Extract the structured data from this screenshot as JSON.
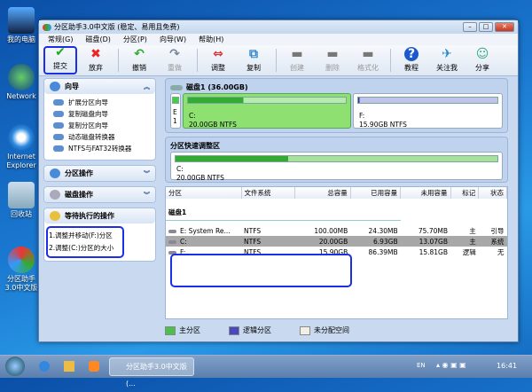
{
  "desktop": {
    "icons": [
      "我的电脑",
      "Network",
      "Internet Explorer",
      "回收站",
      "分区助手3.0中文版"
    ]
  },
  "window": {
    "title": "分区助手3.0中文版 (稳定、易用且免费)",
    "controls": [
      "minimize",
      "maximize",
      "close"
    ]
  },
  "menu": [
    "常规(G)",
    "磁盘(D)",
    "分区(P)",
    "向导(W)",
    "帮助(H)"
  ],
  "toolbar": [
    {
      "label": "提交",
      "icon": "check-icon",
      "enabled": true
    },
    {
      "label": "放弃",
      "icon": "x-icon",
      "enabled": true
    },
    {
      "label": "撤销",
      "icon": "undo-icon",
      "enabled": true
    },
    {
      "label": "重做",
      "icon": "redo-icon",
      "enabled": false
    },
    {
      "label": "调整",
      "icon": "resize-icon",
      "enabled": true
    },
    {
      "label": "复制",
      "icon": "copy-icon",
      "enabled": true
    },
    {
      "label": "创建",
      "icon": "create-icon",
      "enabled": false
    },
    {
      "label": "删除",
      "icon": "delete-icon",
      "enabled": false
    },
    {
      "label": "格式化",
      "icon": "format-icon",
      "enabled": false
    },
    {
      "label": "教程",
      "icon": "help-icon",
      "enabled": true
    },
    {
      "label": "关注我",
      "icon": "follow-icon",
      "enabled": true
    },
    {
      "label": "分享",
      "icon": "share-icon",
      "enabled": true
    }
  ],
  "left": {
    "wizard": {
      "title": "向导",
      "items": [
        "扩展分区向导",
        "复制磁盘向导",
        "复制分区向导",
        "动态磁盘转换器",
        "NTFS与FAT32转换器"
      ]
    },
    "partition_ops": {
      "title": "分区操作"
    },
    "disk_ops": {
      "title": "磁盘操作"
    },
    "pending": {
      "title": "等待执行的操作",
      "items": [
        "1.调整并移动(F:)分区",
        "2.调整(C:)分区的大小"
      ]
    }
  },
  "disk": {
    "title": "磁盘1 (36.00GB)",
    "parts": [
      {
        "label": "E",
        "sub": "1",
        "used_pct": 25
      },
      {
        "label": "C:",
        "size": "20.00GB NTFS",
        "used_pct": 35
      },
      {
        "label": "F:",
        "size": "15.90GB NTFS",
        "used_pct": 1
      }
    ]
  },
  "quick": {
    "title": "分区快速调整区",
    "label": "C:",
    "size": "20.00GB NTFS",
    "used_pct": 35
  },
  "table": {
    "headers": [
      "分区",
      "文件系统",
      "总容量",
      "已用容量",
      "未用容量",
      "标记",
      "状态"
    ],
    "group": "磁盘1",
    "rows": [
      [
        "E: System Re...",
        "NTFS",
        "100.00MB",
        "24.30MB",
        "75.70MB",
        "主",
        "引导"
      ],
      [
        "C:",
        "NTFS",
        "20.00GB",
        "6.93GB",
        "13.07GB",
        "主",
        "系统"
      ],
      [
        "F:",
        "NTFS",
        "15.90GB",
        "86.39MB",
        "15.81GB",
        "逻辑",
        "无"
      ]
    ],
    "selected": 1
  },
  "legend": [
    {
      "label": "主分区",
      "color": "#4cc04c"
    },
    {
      "label": "逻辑分区",
      "color": "#4a4ac0"
    },
    {
      "label": "未分配空间",
      "color": "#f2efe6"
    }
  ],
  "taskbar": {
    "task": "分区助手3.0中文版 (...",
    "lang": "EN",
    "clock": "16:41"
  }
}
